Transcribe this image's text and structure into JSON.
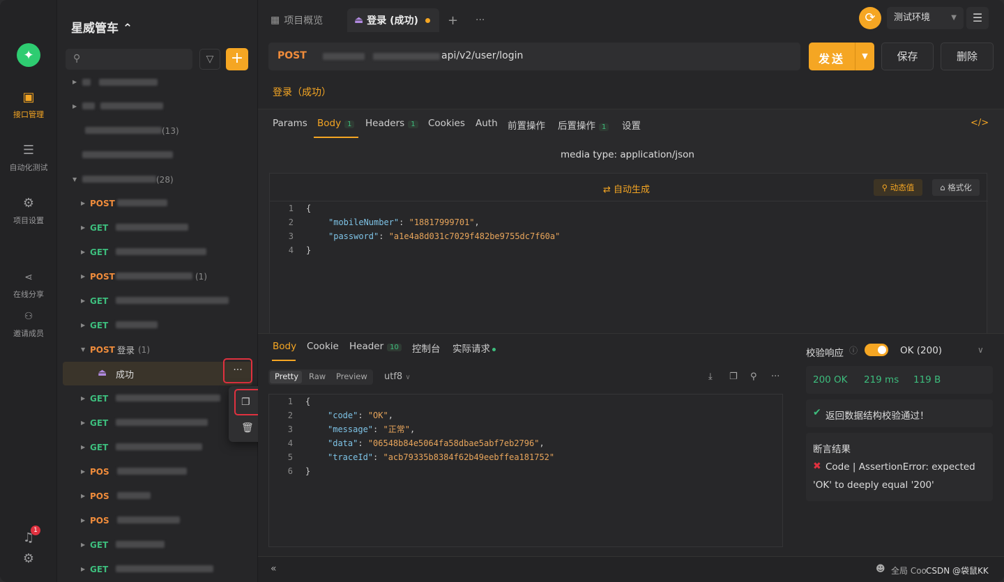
{
  "app": {
    "project_name": "星威管车 ⌃"
  },
  "rail": {
    "items": [
      "接口管理",
      "自动化测试",
      "项目设置",
      "在线分享",
      "邀请成员"
    ],
    "notification_badge": "1"
  },
  "sidebar": {
    "rows": [
      {
        "method": "",
        "label": "",
        "count": "(13)"
      },
      {
        "method": "",
        "label": "",
        "count": "(28)"
      },
      {
        "method": "POST",
        "label": "",
        "count": ""
      },
      {
        "method": "GET",
        "label": "",
        "count": ""
      },
      {
        "method": "GET",
        "label": "",
        "count": ""
      },
      {
        "method": "POST",
        "label": "",
        "count": "(1)"
      },
      {
        "method": "GET",
        "label": "",
        "count": ""
      },
      {
        "method": "GET",
        "label": "",
        "count": ""
      },
      {
        "method": "POST",
        "label": "登录",
        "count": "(1)"
      },
      {
        "method": "",
        "label": "成功",
        "count": ""
      },
      {
        "method": "GET",
        "label": "",
        "count": ""
      },
      {
        "method": "GET",
        "label": "",
        "count": ""
      },
      {
        "method": "GET",
        "label": "",
        "count": ""
      },
      {
        "method": "POS",
        "label": "",
        "count": ""
      },
      {
        "method": "POS",
        "label": "",
        "count": ""
      },
      {
        "method": "POS",
        "label": "",
        "count": ""
      },
      {
        "method": "GET",
        "label": "",
        "count": ""
      },
      {
        "method": "GET",
        "label": "",
        "count": ""
      }
    ],
    "more_label": "···",
    "context_menu": {
      "copy": "复制",
      "delete": "删除"
    }
  },
  "tabs": [
    {
      "label": "项目概览"
    },
    {
      "label": "登录 (成功)"
    }
  ],
  "env": {
    "label": "测试环境"
  },
  "request": {
    "method": "POST",
    "url": "api/v2/user/login",
    "send": "发送",
    "save": "保存",
    "delete": "删除",
    "name": "登录（成功）",
    "tabs": [
      "Params",
      "Body",
      "Headers",
      "Cookies",
      "Auth",
      "前置操作",
      "后置操作",
      "设置"
    ],
    "tab_counts": {
      "body": "1",
      "headers": "1",
      "post": "1"
    },
    "media_type": "media type: application/json",
    "auto_generate": "自动生成",
    "dynamic_value": "动态值",
    "format": "格式化",
    "body_lines": [
      {
        "n": "1",
        "text": "{"
      },
      {
        "n": "2",
        "key": "\"mobileNumber\"",
        "val": "\"18817999701\"",
        "tail": ","
      },
      {
        "n": "3",
        "key": "\"password\"",
        "val": "\"a1e4a8d031c7029f482be9755dc7f60a\"",
        "tail": ""
      },
      {
        "n": "4",
        "text": "}"
      }
    ]
  },
  "response": {
    "tabs": [
      "Body",
      "Cookie",
      "Header",
      "控制台",
      "实际请求"
    ],
    "header_count": "10",
    "view_modes": [
      "Pretty",
      "Raw",
      "Preview"
    ],
    "encoding": "utf8",
    "body_lines": [
      {
        "n": "1",
        "text": "{"
      },
      {
        "n": "2",
        "key": "\"code\"",
        "val": "\"OK\"",
        "tail": ","
      },
      {
        "n": "3",
        "key": "\"message\"",
        "val": "\"正常\"",
        "tail": ","
      },
      {
        "n": "4",
        "key": "\"data\"",
        "val": "\"06548b84e5064fa58dbae5abf7eb2796\"",
        "tail": ","
      },
      {
        "n": "5",
        "key": "\"traceId\"",
        "val": "\"acb79335b8384f62b49eebffea181752\"",
        "tail": ""
      },
      {
        "n": "6",
        "text": "}"
      }
    ],
    "validate_label": "校验响应",
    "status_select": "OK (200)",
    "status": "200 OK",
    "time": "219 ms",
    "size": "119 B",
    "schema_ok": "返回数据结构校验通过！",
    "assert_title": "断言结果",
    "assert_line1": "Code | AssertionError: expected",
    "assert_line2": "'OK' to deeply equal '200'"
  },
  "footer": {
    "global": "全局 Coo",
    "watermark": "CSDN @袋鼠KK"
  },
  "colors": {
    "accent": "#f5a623",
    "post": "#f08c3b",
    "get": "#3dbd7d",
    "error": "#e0313f"
  }
}
